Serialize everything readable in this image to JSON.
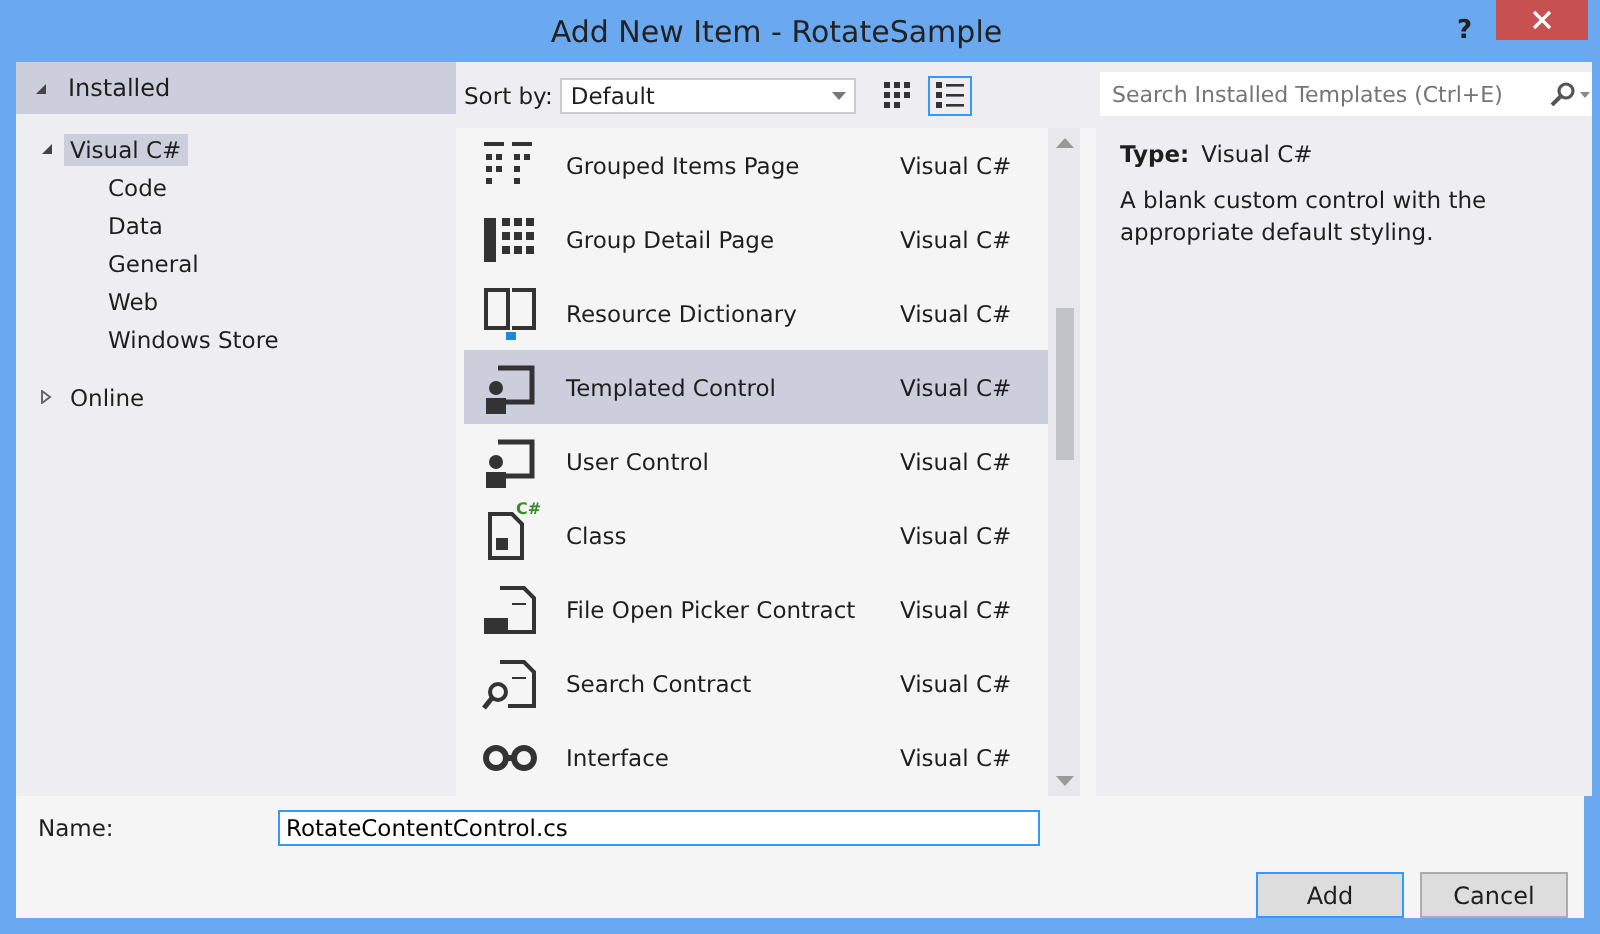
{
  "window": {
    "title": "Add New Item - RotateSample",
    "help": "?"
  },
  "tree": {
    "header": {
      "label": "Installed",
      "expanded": true,
      "selected": true
    },
    "items": [
      {
        "label": "Visual C#",
        "expanded": true,
        "selected": true,
        "children": [
          {
            "label": "Code",
            "selected": false
          },
          {
            "label": "Data",
            "selected": false
          },
          {
            "label": "General",
            "selected": false
          },
          {
            "label": "Web",
            "selected": false
          },
          {
            "label": "Windows Store",
            "selected": false
          }
        ]
      },
      {
        "label": "Online",
        "expanded": false,
        "selected": false
      }
    ]
  },
  "toolbar": {
    "sort_label": "Sort by:",
    "sort_value": "Default",
    "views": [
      {
        "kind": "tiles",
        "selected": false
      },
      {
        "kind": "list",
        "selected": true
      }
    ],
    "search": {
      "placeholder": "Search Installed Templates (Ctrl+E)"
    }
  },
  "templates": [
    {
      "name": "Grouped Items Page",
      "language": "Visual C#",
      "selected": false
    },
    {
      "name": "Group Detail Page",
      "language": "Visual C#",
      "selected": false
    },
    {
      "name": "Resource Dictionary",
      "language": "Visual C#",
      "selected": false
    },
    {
      "name": "Templated Control",
      "language": "Visual C#",
      "selected": true
    },
    {
      "name": "User Control",
      "language": "Visual C#",
      "selected": false
    },
    {
      "name": "Class",
      "language": "Visual C#",
      "selected": false,
      "badge": "C#"
    },
    {
      "name": "File Open Picker Contract",
      "language": "Visual C#",
      "selected": false
    },
    {
      "name": "Search Contract",
      "language": "Visual C#",
      "selected": false
    },
    {
      "name": "Interface",
      "language": "Visual C#",
      "selected": false
    }
  ],
  "details": {
    "type_label": "Type:",
    "type_value": "Visual C#",
    "description": "A blank custom control with the appropriate default styling."
  },
  "name_field": {
    "label": "Name:",
    "value": "RotateContentControl.cs"
  },
  "buttons": [
    {
      "label": "Add",
      "default": true
    },
    {
      "label": "Cancel",
      "default": false
    }
  ]
}
